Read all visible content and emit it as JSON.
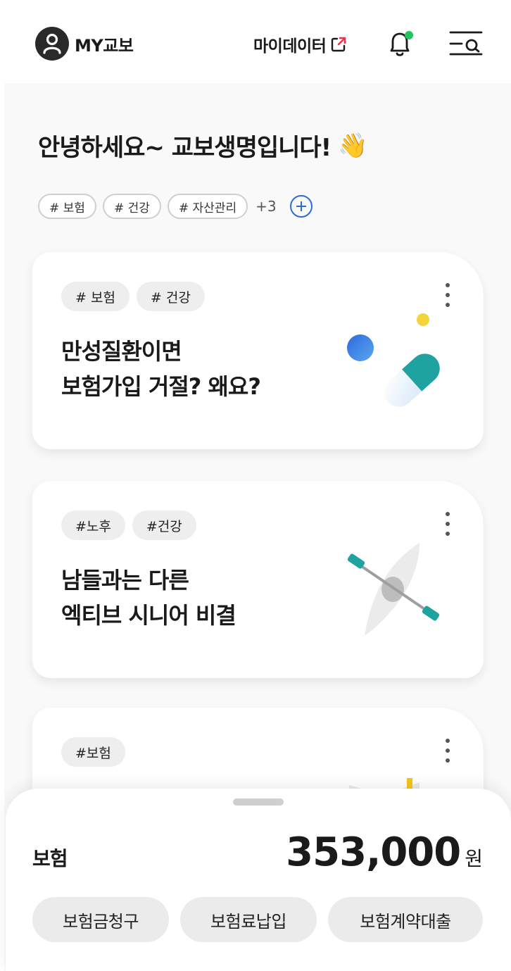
{
  "header": {
    "my_label": "MY교보",
    "mydata_label": "마이데이터",
    "notification_dot_color": "#22c55e",
    "accent_color": "#e8384f"
  },
  "greeting": {
    "text": "안녕하세요~ 교보생명입니다!",
    "emoji": "👋"
  },
  "interest_chips": [
    "# 보험",
    "# 건강",
    "# 자산관리"
  ],
  "more_count": "+3",
  "cards": [
    {
      "tags": [
        "# 보험",
        "# 건강"
      ],
      "title_line1": "만성질환이면",
      "title_line2": "보험가입 거절? 왜요?",
      "illustration": "pill-icon"
    },
    {
      "tags": [
        "#노후",
        "#건강"
      ],
      "title_line1": "남들과는 다른",
      "title_line2": "엑티브 시니어 비결",
      "illustration": "kayak-icon"
    },
    {
      "tags": [
        "#보험"
      ],
      "title_line1": "",
      "title_line2": "",
      "illustration": "envelope-icon"
    }
  ],
  "sheet": {
    "label": "보험",
    "amount": "353,000",
    "unit": "원",
    "actions": [
      "보험금청구",
      "보험료납입",
      "보험계약대출"
    ]
  }
}
